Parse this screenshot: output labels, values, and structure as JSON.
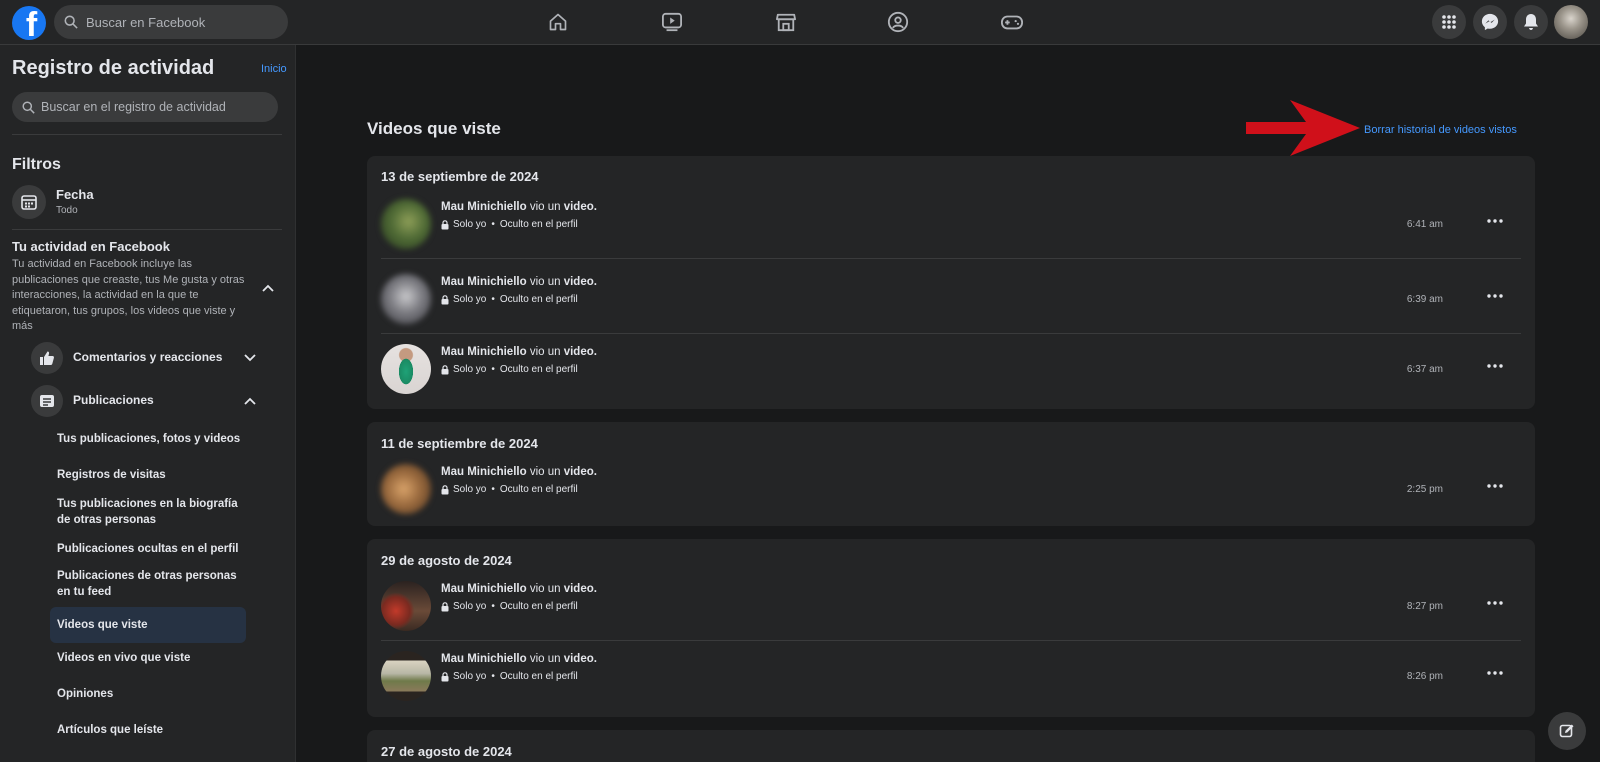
{
  "topbar": {
    "search_placeholder": "Buscar en Facebook",
    "nav_icons": [
      "home-icon",
      "watch-icon",
      "marketplace-icon",
      "groups-icon",
      "gaming-icon"
    ],
    "right_icons": [
      "menu-grid-icon",
      "messenger-icon",
      "notifications-icon"
    ]
  },
  "sidebar": {
    "title": "Registro de actividad",
    "home_link": "Inicio",
    "search_placeholder": "Buscar en el registro de actividad",
    "filters_heading": "Filtros",
    "date_filter": {
      "label": "Fecha",
      "value": "Todo"
    },
    "activity_title": "Tu actividad en Facebook",
    "activity_desc": "Tu actividad en Facebook incluye las publicaciones que creaste, tus Me gusta y otras interacciones, la actividad en la que te etiquetaron, tus grupos, los videos que viste y más",
    "categories": [
      {
        "label": "Comentarios y reacciones",
        "icon": "thumbs-up-icon"
      },
      {
        "label": "Publicaciones",
        "icon": "posts-icon"
      }
    ],
    "sub_items": [
      "Tus publicaciones, fotos y videos",
      "Registros de visitas",
      "Tus publicaciones en la biografía de otras personas",
      "Publicaciones ocultas en el perfil",
      "Publicaciones de otras personas en tu feed",
      "Videos que viste",
      "Videos en vivo que viste",
      "Opiniones",
      "Artículos que leíste"
    ],
    "active_item": "Videos que viste"
  },
  "main": {
    "title": "Videos que viste",
    "clear_link": "Borrar historial de videos vistos",
    "action_suffix": "vio un",
    "action_object": "video.",
    "privacy": "Solo yo",
    "visibility": "Oculto en el perfil",
    "groups": [
      {
        "date": "13 de septiembre de 2024",
        "entries": [
          {
            "user": "Mau Minichiello",
            "time": "6:41 am"
          },
          {
            "user": "Mau Minichiello",
            "time": "6:39 am"
          },
          {
            "user": "Mau Minichiello",
            "time": "6:37 am"
          }
        ]
      },
      {
        "date": "11 de septiembre de 2024",
        "entries": [
          {
            "user": "Mau Minichiello",
            "time": "2:25 pm"
          }
        ]
      },
      {
        "date": "29 de agosto de 2024",
        "entries": [
          {
            "user": "Mau Minichiello",
            "time": "8:27 pm"
          },
          {
            "user": "Mau Minichiello",
            "time": "8:26 pm"
          }
        ]
      },
      {
        "date": "27 de agosto de 2024",
        "entries": []
      }
    ]
  },
  "colors": {
    "background": "#18191a",
    "surface": "#242526",
    "accent_link": "#4599ff",
    "annotation_arrow": "#d0101a"
  }
}
